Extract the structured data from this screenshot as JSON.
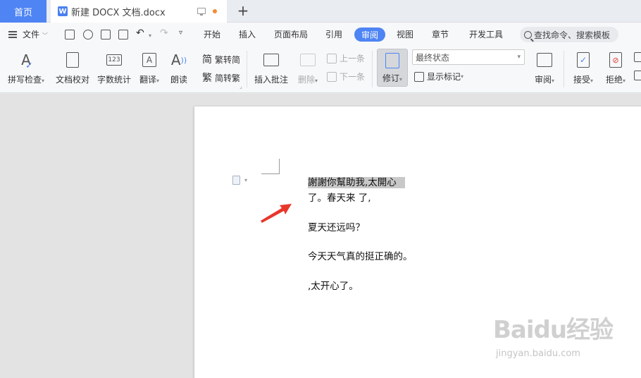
{
  "tabs": {
    "home": "首页",
    "document": "新建 DOCX 文档.docx",
    "new_tab": "+"
  },
  "menu": {
    "file": "文件",
    "items": [
      "开始",
      "插入",
      "页面布局",
      "引用",
      "审阅",
      "视图",
      "章节",
      "开发工具"
    ],
    "active": "审阅",
    "search_placeholder": "查找命令、搜索模板"
  },
  "ribbon": {
    "spell_check": "拼写检查",
    "doc_proofread": "文档校对",
    "word_count": "字数统计",
    "translate": "翻译",
    "read_aloud": "朗读",
    "trad_to_simp": "繁转简",
    "simp_to_trad": "简转繁",
    "insert_comment": "插入批注",
    "delete": "删除",
    "prev": "上一条",
    "next": "下一条",
    "revise": "修订",
    "final_state": "最终状态",
    "show_markup": "显示标记",
    "review": "审阅",
    "accept": "接受",
    "reject": "拒绝"
  },
  "document": {
    "lines": [
      "謝謝你幫助我,太開心",
      "了。春天来        了,",
      "夏天还远吗？",
      "今天天气真的挺正确的。",
      ",太开心了。"
    ]
  },
  "watermark": {
    "brand": "Baidu经验",
    "url": "jingyan.baidu.com"
  },
  "colors": {
    "accent": "#4e84f4",
    "arrow": "#e8362c"
  }
}
